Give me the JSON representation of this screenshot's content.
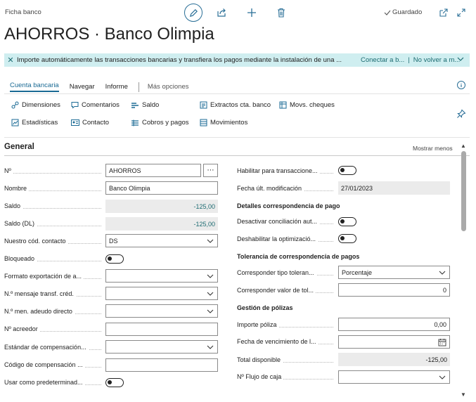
{
  "breadcrumb": "Ficha banco",
  "toolbar": {
    "saved_label": "Guardado"
  },
  "title": "AHORROS · Banco Olimpia",
  "banner": {
    "message": "Importe automáticamente las transacciones bancarias y transfiera los pagos mediante la instalación de una ...",
    "link1": "Conectar a b...",
    "link2": "No volver a m..."
  },
  "tabs": [
    "Cuenta bancaria",
    "Navegar",
    "Informe",
    "Más opciones"
  ],
  "actions": {
    "dimensiones": "Dimensiones",
    "comentarios": "Comentarios",
    "saldo": "Saldo",
    "extractos": "Extractos cta. banco",
    "movs_cheques": "Movs. cheques",
    "estadisticas": "Estadísticas",
    "contacto": "Contacto",
    "cobros": "Cobros y pagos",
    "movimientos": "Movimientos"
  },
  "section": {
    "title": "General",
    "toggle_label": "Mostrar menos"
  },
  "left": {
    "no_label": "Nº",
    "no_value": "AHORROS",
    "nombre_label": "Nombre",
    "nombre_value": "Banco Olimpia",
    "saldo_label": "Saldo",
    "saldo_value": "-125,00",
    "saldo_dl_label": "Saldo (DL)",
    "saldo_dl_value": "-125,00",
    "contacto_label": "Nuestro cód. contacto",
    "contacto_value": "DS",
    "bloqueado_label": "Bloqueado",
    "formato_label": "Formato exportación de a...",
    "mensaje_label": "N.º mensaje transf. créd.",
    "adeudo_label": "N.º men. adeudo directo",
    "acreedor_label": "Nº acreedor",
    "estandar_label": "Estándar de compensación...",
    "codigo_label": "Código de compensación ...",
    "predeterminado_label": "Usar como predeterminad..."
  },
  "right": {
    "habilitar_label": "Habilitar para transaccione...",
    "fecha_mod_label": "Fecha últ. modificación",
    "fecha_mod_value": "27/01/2023",
    "grp_detalles": "Detalles correspondencia de pago",
    "desactivar_label": "Desactivar conciliación aut...",
    "deshabilitar_label": "Deshabilitar la optimizació...",
    "grp_tolerancia": "Tolerancia de correspondencia de pagos",
    "tipo_tol_label": "Corresponder tipo toleran...",
    "tipo_tol_value": "Porcentaje",
    "valor_tol_label": "Corresponder valor de tol...",
    "valor_tol_value": "0",
    "grp_polizas": "Gestión de pólizas",
    "importe_label": "Importe póliza",
    "importe_value": "0,00",
    "vencimiento_label": "Fecha de vencimiento de l...",
    "total_label": "Total disponible",
    "total_value": "-125,00",
    "flujo_label": "Nº Flujo de caja"
  }
}
